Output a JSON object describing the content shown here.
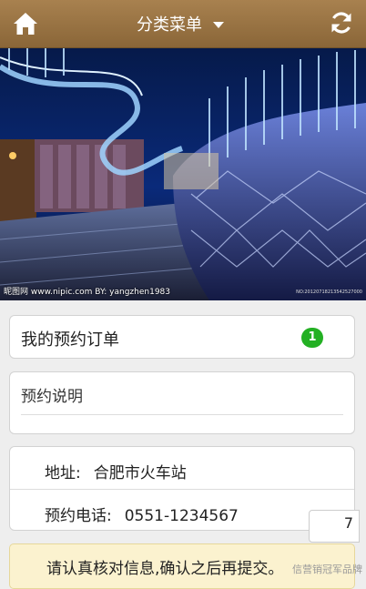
{
  "header": {
    "title": "分类菜单",
    "home_icon": "home-icon",
    "dropdown_icon": "caret-down-icon",
    "refresh_icon": "refresh-icon",
    "bg_color": "#9a7443"
  },
  "banner": {
    "watermark_left": "昵图网 www.nipic.com   BY: yangzhen1983",
    "watermark_right": "NO:20120718213542527000"
  },
  "orders": {
    "label": "我的预约订单",
    "badge_count": "1",
    "badge_color": "#23b023"
  },
  "notes": {
    "label": "预约说明"
  },
  "info": {
    "address_label": "地址:",
    "address_value": "合肥市火车站",
    "phone_label": "预约电话:",
    "phone_value": "0551-1234567"
  },
  "float_button": {
    "label": "7"
  },
  "notice": {
    "text": "请认真核对信息,确认之后再提交。",
    "bg_color": "#fbf2cf"
  },
  "brand_watermark": "信营销冠军品牌"
}
